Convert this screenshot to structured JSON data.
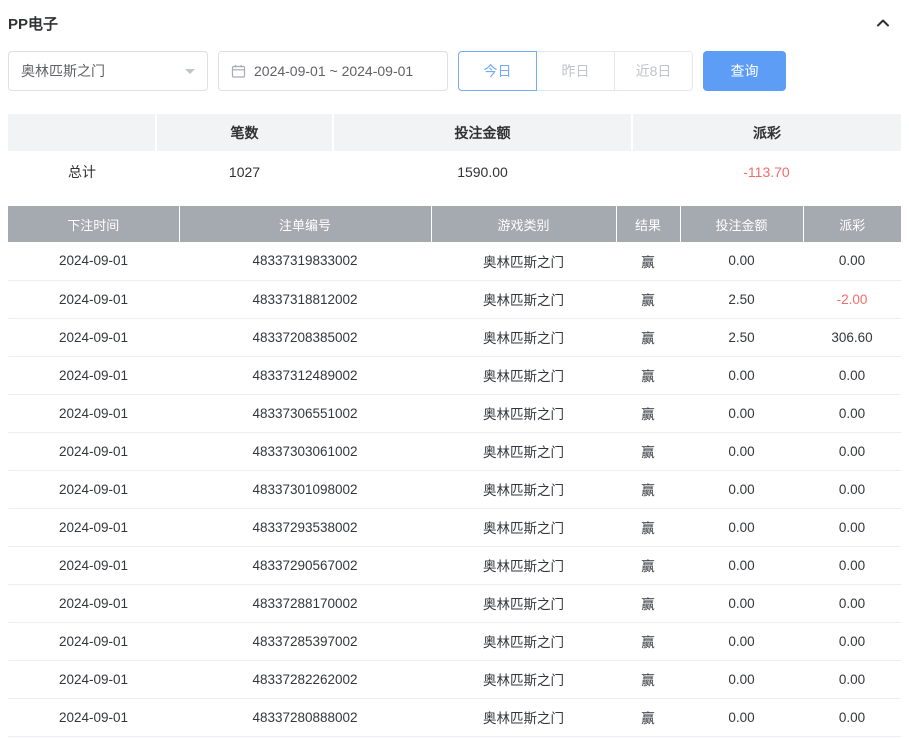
{
  "panel": {
    "title": "PP电子"
  },
  "filters": {
    "game_select_value": "奥林匹斯之门",
    "date_range_value": "2024-09-01 ~ 2024-09-01",
    "quick_buttons": [
      {
        "label": "今日",
        "active": true
      },
      {
        "label": "昨日",
        "active": false
      },
      {
        "label": "近8日",
        "active": false
      }
    ],
    "search_label": "查询"
  },
  "summary": {
    "headers": [
      "",
      "笔数",
      "投注金额",
      "派彩"
    ],
    "row": [
      "总计",
      "1027",
      "1590.00",
      "-113.70"
    ]
  },
  "table": {
    "headers": [
      "下注时间",
      "注单编号",
      "游戏类别",
      "结果",
      "投注金额",
      "派彩"
    ],
    "rows": [
      [
        "2024-09-01",
        "48337319833002",
        "奥林匹斯之门",
        "赢",
        "0.00",
        "0.00"
      ],
      [
        "2024-09-01",
        "48337318812002",
        "奥林匹斯之门",
        "赢",
        "2.50",
        "-2.00"
      ],
      [
        "2024-09-01",
        "48337208385002",
        "奥林匹斯之门",
        "赢",
        "2.50",
        "306.60"
      ],
      [
        "2024-09-01",
        "48337312489002",
        "奥林匹斯之门",
        "赢",
        "0.00",
        "0.00"
      ],
      [
        "2024-09-01",
        "48337306551002",
        "奥林匹斯之门",
        "赢",
        "0.00",
        "0.00"
      ],
      [
        "2024-09-01",
        "48337303061002",
        "奥林匹斯之门",
        "赢",
        "0.00",
        "0.00"
      ],
      [
        "2024-09-01",
        "48337301098002",
        "奥林匹斯之门",
        "赢",
        "0.00",
        "0.00"
      ],
      [
        "2024-09-01",
        "48337293538002",
        "奥林匹斯之门",
        "赢",
        "0.00",
        "0.00"
      ],
      [
        "2024-09-01",
        "48337290567002",
        "奥林匹斯之门",
        "赢",
        "0.00",
        "0.00"
      ],
      [
        "2024-09-01",
        "48337288170002",
        "奥林匹斯之门",
        "赢",
        "0.00",
        "0.00"
      ],
      [
        "2024-09-01",
        "48337285397002",
        "奥林匹斯之门",
        "赢",
        "0.00",
        "0.00"
      ],
      [
        "2024-09-01",
        "48337282262002",
        "奥林匹斯之门",
        "赢",
        "0.00",
        "0.00"
      ],
      [
        "2024-09-01",
        "48337280888002",
        "奥林匹斯之门",
        "赢",
        "0.00",
        "0.00"
      ]
    ]
  },
  "colors": {
    "accent_blue": "#5e9df5",
    "negative_red": "#f56c6c",
    "table_header_gray": "#a5a9b0"
  }
}
